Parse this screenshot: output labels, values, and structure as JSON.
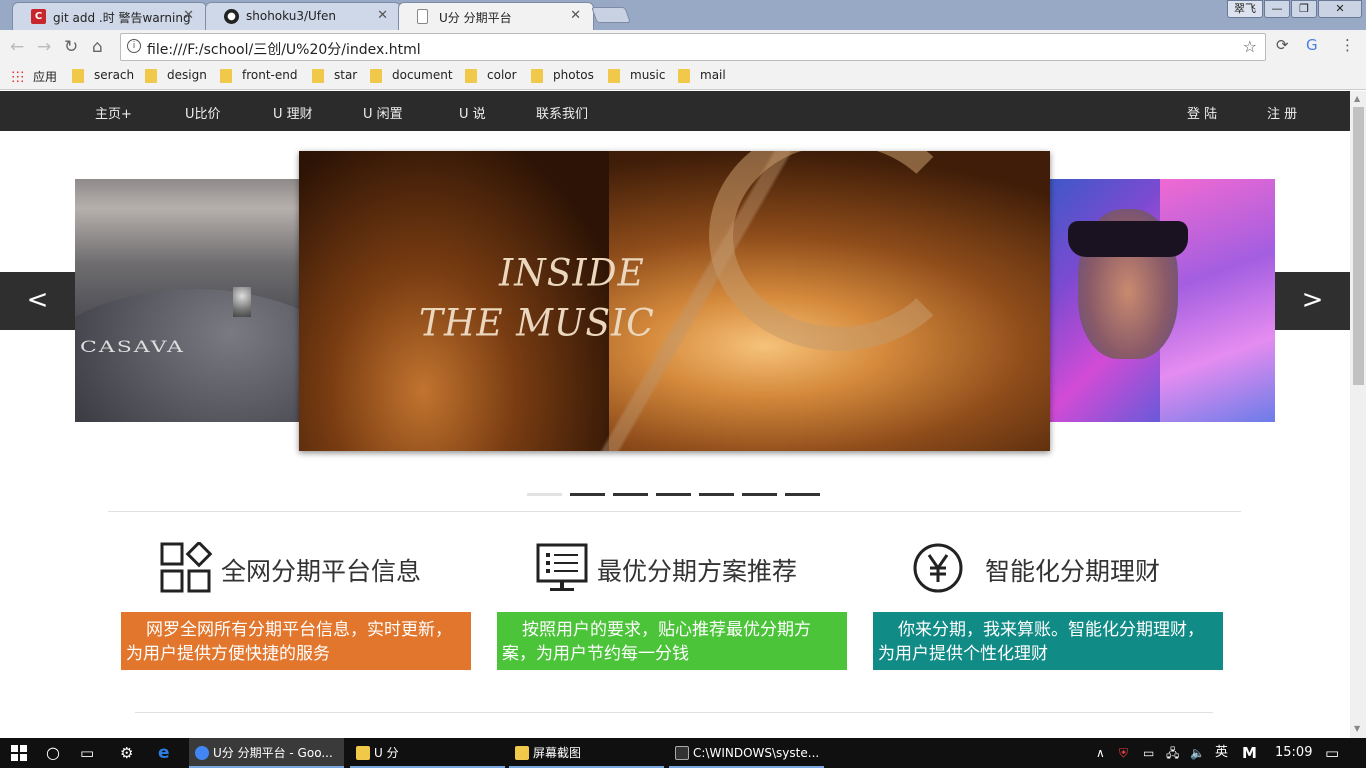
{
  "browser": {
    "tabs": [
      {
        "title": "git add .时 警告warning",
        "icon": "csdn-icon",
        "icon_color": "#c9252c"
      },
      {
        "title": "shohoku3/Ufen",
        "icon": "github-icon",
        "icon_color": "#222222"
      },
      {
        "title": "U分 分期平台",
        "icon": "page-icon",
        "icon_color": "#ffffff"
      }
    ],
    "window_user": "翠飞",
    "url": "file:///F:/school/三创/U%20分/index.html",
    "bookmarks": [
      "应用",
      "serach",
      "design",
      "front-end",
      "star",
      "document",
      "color",
      "photos",
      "music",
      "mail"
    ]
  },
  "site": {
    "nav": [
      "主页+",
      "U比价",
      "U 理财",
      "U 闲置",
      "U 说",
      "联系我们"
    ],
    "login": "登 陆",
    "register": "注 册",
    "carousel": {
      "prev": "<",
      "next": ">",
      "caption_line1": "INSIDE",
      "caption_line2": "THE MUSIC",
      "left_text": "CASAVA",
      "dot_count": 7,
      "active_dot": 0
    },
    "features": [
      {
        "title": "全网分期平台信息",
        "icon": "grid-apps-icon",
        "desc": "网罗全网所有分期平台信息，实时更新，为用户提供方便快捷的服务",
        "color": "#e2762d"
      },
      {
        "title": "最优分期方案推荐",
        "icon": "monitor-list-icon",
        "desc": "按照用户的要求，贴心推荐最优分期方案，为用户节约每一分钱",
        "color": "#4bc43a"
      },
      {
        "title": "智能化分期理财",
        "icon": "yen-circle-icon",
        "desc": "你来分期，我来算账。智能化分期理财，为用户提供个性化理财",
        "color": "#108b86"
      }
    ]
  },
  "taskbar": {
    "apps": [
      {
        "label": "U分 分期平台 - Goo...",
        "icon": "chrome-icon",
        "color": "#4285f4",
        "active": true
      },
      {
        "label": "U 分",
        "icon": "folder-icon",
        "color": "#f0c84a",
        "active": false
      },
      {
        "label": "屏幕截图",
        "icon": "folder-icon",
        "color": "#f0c84a",
        "active": false
      },
      {
        "label": "C:\\WINDOWS\\syste...",
        "icon": "cmd-icon",
        "color": "#333333",
        "active": false
      }
    ],
    "ime": "英",
    "ime2": "M",
    "time": "15:09"
  }
}
